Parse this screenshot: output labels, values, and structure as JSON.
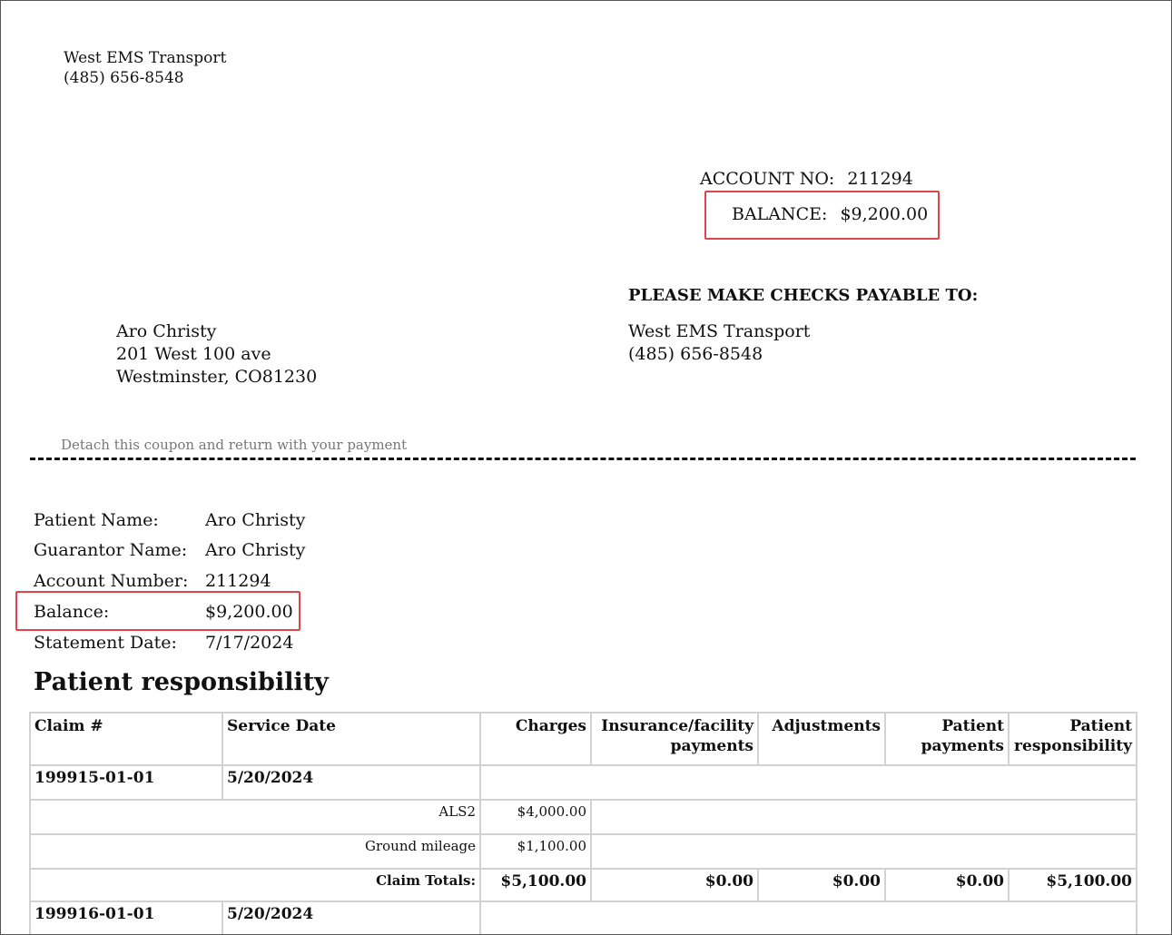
{
  "sender": {
    "name": "West EMS Transport",
    "phone": "(485) 656-8548"
  },
  "account": {
    "account_label": "ACCOUNT NO:",
    "account_no": "211294",
    "balance_label": "BALANCE:",
    "balance": "$9,200.00"
  },
  "payable": {
    "heading": "PLEASE MAKE CHECKS PAYABLE TO:",
    "name": "West EMS Transport",
    "phone": "(485) 656-8548"
  },
  "recipient": {
    "name": "Aro Christy",
    "street": "201 West 100 ave",
    "city": "Westminster, CO81230"
  },
  "detach_text": "Detach this coupon and return with your payment",
  "info": [
    {
      "label": "Patient Name:",
      "value": "Aro Christy"
    },
    {
      "label": "Guarantor Name:",
      "value": "Aro Christy"
    },
    {
      "label": "Account Number:",
      "value": "211294"
    },
    {
      "label": "Balance:",
      "value": "$9,200.00"
    },
    {
      "label": "Statement Date:",
      "value": "7/17/2024"
    }
  ],
  "section_title": "Patient responsibility",
  "table": {
    "headers": [
      "Claim #",
      "Service Date",
      "Charges",
      "Insurance/facility payments",
      "Adjustments",
      "Patient payments",
      "Patient responsibility"
    ],
    "claims": [
      {
        "claim": "199915-01-01",
        "date": "5/20/2024",
        "lines": [
          {
            "desc": "ALS2",
            "charge": "$4,000.00"
          },
          {
            "desc": "Ground mileage",
            "charge": "$1,100.00"
          }
        ],
        "totals": {
          "label": "Claim Totals:",
          "charges": "$5,100.00",
          "insurance": "$0.00",
          "adjustments": "$0.00",
          "patient_payments": "$0.00",
          "responsibility": "$5,100.00"
        }
      },
      {
        "claim": "199916-01-01",
        "date": "5/20/2024"
      }
    ]
  }
}
